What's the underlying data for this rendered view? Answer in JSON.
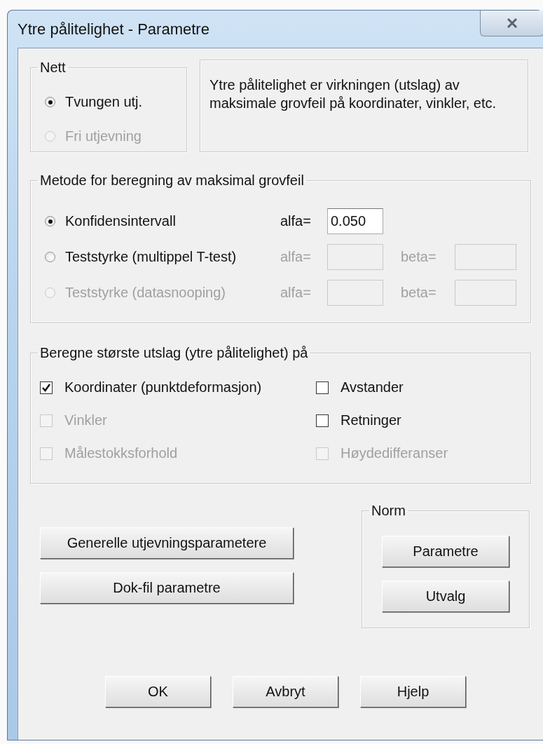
{
  "window": {
    "title": "Ytre pålitelighet - Parametre"
  },
  "nett": {
    "legend": "Nett",
    "options": [
      {
        "label": "Tvungen utj.",
        "selected": true,
        "disabled": false
      },
      {
        "label": "Fri utjevning",
        "selected": false,
        "disabled": true
      }
    ]
  },
  "info": {
    "text": "Ytre pålitelighet er virkningen (utslag) av maksimale grovfeil på koordinater, vinkler, etc."
  },
  "metode": {
    "legend": "Metode for beregning av maksimal grovfeil",
    "options": [
      {
        "label": "Konfidensintervall",
        "selected": true,
        "disabled": false,
        "fields": [
          {
            "label": "alfa=",
            "value": "0.050",
            "disabled": false
          }
        ]
      },
      {
        "label": "Teststyrke (multippel T-test)",
        "selected": false,
        "disabled": false,
        "fields": [
          {
            "label": "alfa=",
            "disabled": true
          },
          {
            "label": "beta=",
            "disabled": true
          }
        ]
      },
      {
        "label": "Teststyrke (datasnooping)",
        "selected": false,
        "disabled": true,
        "fields": [
          {
            "label": "alfa=",
            "disabled": true
          },
          {
            "label": "beta=",
            "disabled": true
          }
        ]
      }
    ]
  },
  "beregne": {
    "legend": "Beregne største utslag (ytre pålitelighet) på",
    "checkboxes": [
      {
        "label": "Koordinater (punktdeformasjon)",
        "checked": true,
        "disabled": false
      },
      {
        "label": "Avstander",
        "checked": false,
        "disabled": false
      },
      {
        "label": "Vinkler",
        "checked": false,
        "disabled": true
      },
      {
        "label": "Retninger",
        "checked": false,
        "disabled": false
      },
      {
        "label": "Målestokksforhold",
        "checked": false,
        "disabled": true
      },
      {
        "label": "Høydedifferanser",
        "checked": false,
        "disabled": true
      }
    ]
  },
  "side_buttons": [
    "Generelle utjevningsparametere",
    "Dok-fil parametre"
  ],
  "norm": {
    "legend": "Norm",
    "buttons": [
      "Parametre",
      "Utvalg"
    ]
  },
  "footer_buttons": [
    "OK",
    "Avbryt",
    "Hjelp"
  ]
}
